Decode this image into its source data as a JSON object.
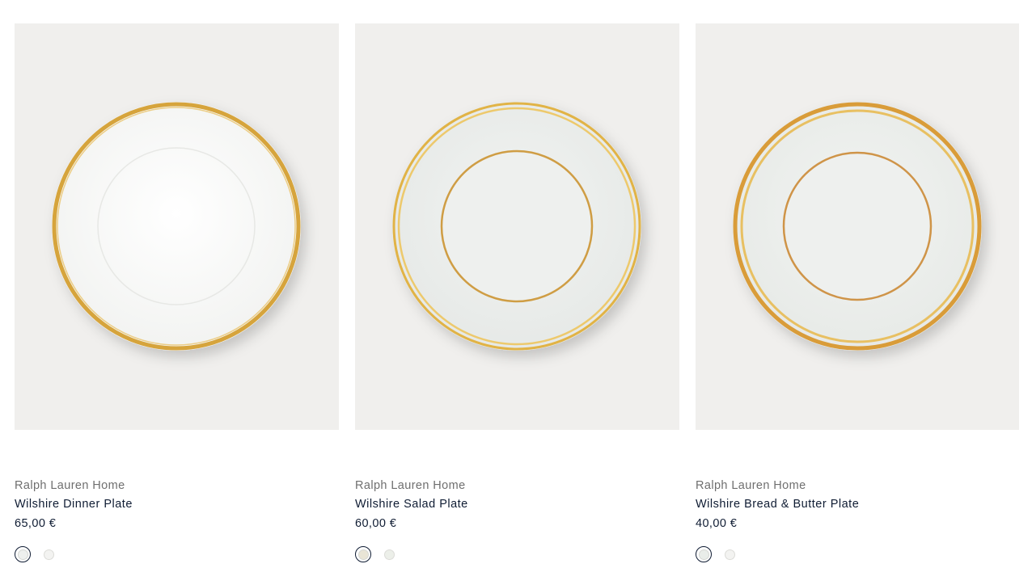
{
  "products": [
    {
      "brand": "Ralph Lauren Home",
      "name": "Wilshire Dinner Plate",
      "price": "65,00 €",
      "image_alt": "Wilshire Dinner Plate",
      "swatches": [
        "gold",
        "white"
      ]
    },
    {
      "brand": "Ralph Lauren Home",
      "name": "Wilshire Salad Plate",
      "price": "60,00 €",
      "image_alt": "Wilshire Salad Plate",
      "swatches": [
        "gold",
        "white"
      ]
    },
    {
      "brand": "Ralph Lauren Home",
      "name": "Wilshire Bread & Butter Plate",
      "price": "40,00 €",
      "image_alt": "Wilshire Bread & Butter Plate",
      "swatches": [
        "gold",
        "white"
      ]
    }
  ],
  "colors": {
    "image_background": "#f0efed",
    "gold_rim": "#d8a841",
    "plate_white": "#f6f7f5",
    "text_primary": "#0f1c33",
    "text_secondary": "#6f6f6f"
  }
}
